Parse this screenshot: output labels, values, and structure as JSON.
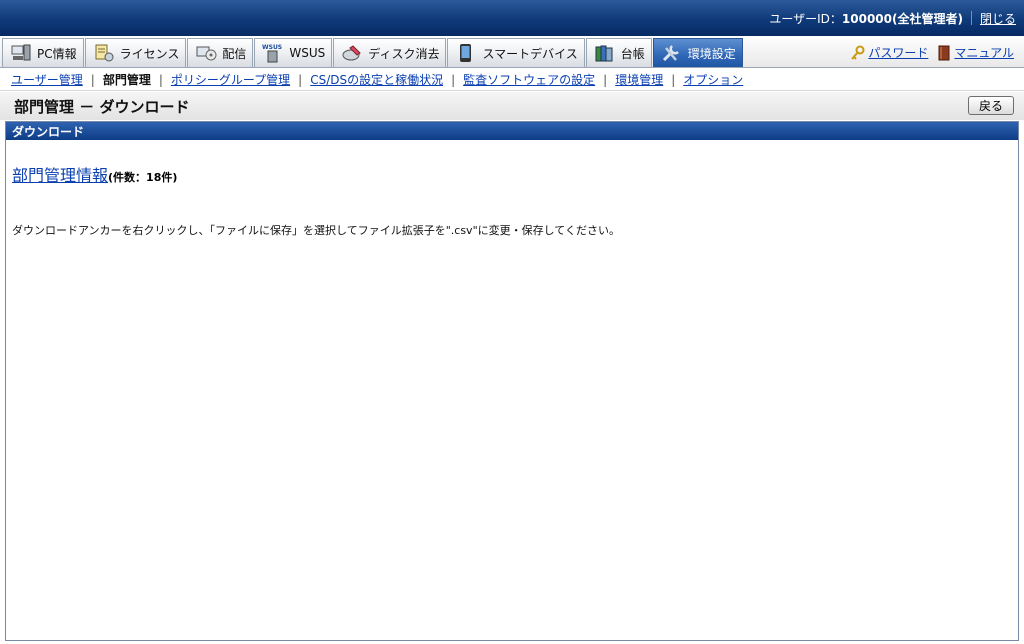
{
  "header": {
    "user_label": "ユーザーID：",
    "user_id": "100000",
    "user_role": "(全社管理者)",
    "close_link": "閉じる"
  },
  "tabs": [
    {
      "label": "PC情報",
      "icon": "pc-icon"
    },
    {
      "label": "ライセンス",
      "icon": "license-icon"
    },
    {
      "label": "配信",
      "icon": "distribution-icon"
    },
    {
      "label": "WSUS",
      "icon": "wsus-icon"
    },
    {
      "label": "ディスク消去",
      "icon": "disk-erase-icon"
    },
    {
      "label": "スマートデバイス",
      "icon": "smart-device-icon"
    },
    {
      "label": "台帳",
      "icon": "ledger-icon"
    },
    {
      "label": "環境設定",
      "icon": "settings-tools-icon",
      "active": true
    }
  ],
  "right_links": {
    "password": "パスワード",
    "manual": "マニュアル"
  },
  "submenu": {
    "items": [
      {
        "label": "ユーザー管理",
        "current": false
      },
      {
        "label": "部門管理",
        "current": true
      },
      {
        "label": "ポリシーグループ管理",
        "current": false
      },
      {
        "label": "CS/DSの設定と稼働状況",
        "current": false
      },
      {
        "label": "監査ソフトウェアの設定",
        "current": false
      },
      {
        "label": "環境管理",
        "current": false
      },
      {
        "label": "オプション",
        "current": false
      }
    ]
  },
  "page": {
    "title": "部門管理 － ダウンロード",
    "back_button": "戻る"
  },
  "panel": {
    "heading": "ダウンロード",
    "info_link": "部門管理情報",
    "count_text": "(件数：18件)",
    "note": "ダウンロードアンカーを右クリックし、「ファイルに保存」を選択してファイル拡張子を\".csv\"に変更・保存してください。"
  },
  "colors": {
    "accent": "#0f3a7a",
    "link": "#0a3fb0",
    "active_tab": "#2f67b6"
  }
}
